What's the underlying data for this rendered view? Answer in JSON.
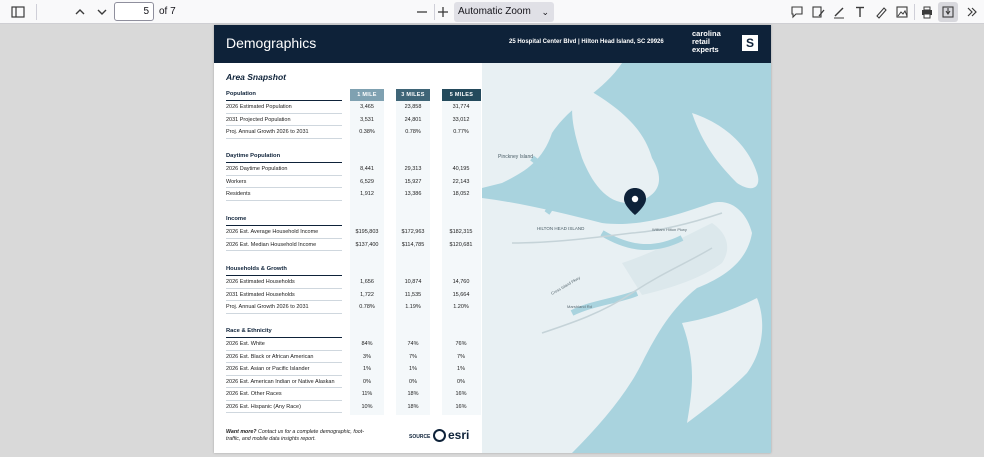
{
  "toolbar": {
    "page_number": "5",
    "page_count": "of 7",
    "zoom": "Automatic Zoom",
    "icons": [
      "sidebar-toggle-icon",
      "up-icon",
      "down-icon",
      "minus-icon",
      "plus-icon",
      "comment-icon",
      "highlight-icon",
      "draw-icon",
      "text-icon",
      "ink-icon",
      "image-icon",
      "print-icon",
      "save-icon",
      "more-icon"
    ]
  },
  "document": {
    "header_title": "Demographics",
    "address": "25 Hospital Center Blvd | Hilton Head Island, SC 29926",
    "brand": [
      "carolina",
      "retail",
      "experts"
    ],
    "brand_mark": "S",
    "snapshot_title": "Area Snapshot",
    "columns": [
      "1 MILE",
      "3 MILES",
      "5 MILES"
    ],
    "sections": [
      {
        "title": "Population",
        "rows": [
          {
            "label": "2026 Estimated Population",
            "values": [
              "3,465",
              "23,858",
              "31,774"
            ]
          },
          {
            "label": "2031 Projected Population",
            "values": [
              "3,531",
              "24,801",
              "33,012"
            ]
          },
          {
            "label": "Proj. Annual Growth 2026 to 2031",
            "values": [
              "0.38%",
              "0.78%",
              "0.77%"
            ]
          }
        ]
      },
      {
        "title": "Daytime Population",
        "rows": [
          {
            "label": "2026 Daytime Population",
            "values": [
              "8,441",
              "29,313",
              "40,195"
            ]
          },
          {
            "label": "Workers",
            "values": [
              "6,529",
              "15,927",
              "22,143"
            ]
          },
          {
            "label": "Residents",
            "values": [
              "1,912",
              "13,386",
              "18,052"
            ]
          }
        ]
      },
      {
        "title": "Income",
        "rows": [
          {
            "label": "2026 Est. Average Household Income",
            "values": [
              "$195,803",
              "$172,963",
              "$182,315"
            ]
          },
          {
            "label": "2026 Est. Median Household Income",
            "values": [
              "$137,400",
              "$114,785",
              "$120,681"
            ]
          }
        ]
      },
      {
        "title": "Households & Growth",
        "rows": [
          {
            "label": "2026 Estimated Households",
            "values": [
              "1,656",
              "10,874",
              "14,760"
            ]
          },
          {
            "label": "2031 Estimated Households",
            "values": [
              "1,722",
              "11,535",
              "15,664"
            ]
          },
          {
            "label": "Proj. Annual Growth 2026 to 2031",
            "values": [
              "0.78%",
              "1.19%",
              "1.20%"
            ]
          }
        ]
      },
      {
        "title": "Race & Ethnicity",
        "rows": [
          {
            "label": "2026 Est. White",
            "values": [
              "84%",
              "74%",
              "76%"
            ]
          },
          {
            "label": "2026 Est. Black or African American",
            "values": [
              "3%",
              "7%",
              "7%"
            ]
          },
          {
            "label": "2026 Est. Asian or Pacific Islander",
            "values": [
              "1%",
              "1%",
              "1%"
            ]
          },
          {
            "label": "2026 Est. American Indian or Native Alaskan",
            "values": [
              "0%",
              "0%",
              "0%"
            ]
          },
          {
            "label": "2026 Est. Other Races",
            "values": [
              "11%",
              "18%",
              "16%"
            ]
          },
          {
            "label": "2026 Est. Hispanic (Any Race)",
            "values": [
              "10%",
              "18%",
              "16%"
            ]
          }
        ]
      }
    ],
    "footer": {
      "note_bold": "Want more?",
      "note_text": " Contact us for a complete demographic, foot-traffic, and mobile data insights report.",
      "source_label": "SOURCE",
      "source_brand": "esri"
    },
    "map": {
      "labels": [
        "Pinckney Island",
        "HILTON HEAD ISLAND",
        "William Hilton Pkwy",
        "Cross Island Pkwy",
        "Marshland Rd"
      ]
    }
  },
  "colors": {
    "header_bg": "#0e2239",
    "col1": "#7fa1b1",
    "col2": "#3f6577",
    "col3": "#244a5c",
    "water": "#a9d3de"
  }
}
